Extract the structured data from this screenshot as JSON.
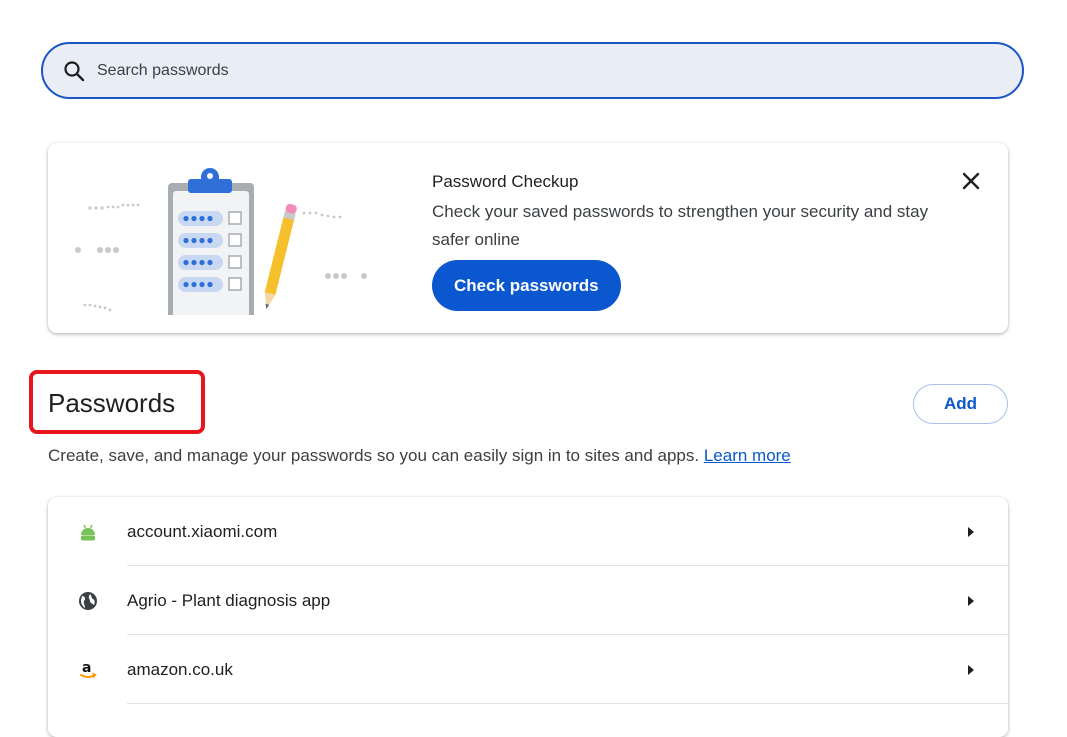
{
  "search": {
    "placeholder": "Search passwords",
    "value": ""
  },
  "checkup": {
    "title": "Password Checkup",
    "body": "Check your saved passwords to strengthen your security and stay safer online",
    "button_label": "Check passwords",
    "close_icon": "close-icon"
  },
  "passwords": {
    "title": "Passwords",
    "add_label": "Add",
    "description": "Create, save, and manage your passwords so you can easily sign in to sites and apps.",
    "learn_more": "Learn more",
    "items": [
      {
        "site": "account.xiaomi.com",
        "icon": "android-icon"
      },
      {
        "site": "Agrio - Plant diagnosis app",
        "icon": "globe-icon"
      },
      {
        "site": "amazon.co.uk",
        "icon": "amazon-icon"
      }
    ]
  },
  "colors": {
    "accent": "#0b57d0",
    "search_border": "#1a56c4",
    "search_bg": "#e9edf6",
    "highlight": "#e8151c",
    "android_green": "#78c257",
    "amazon_orange": "#ff9900"
  }
}
